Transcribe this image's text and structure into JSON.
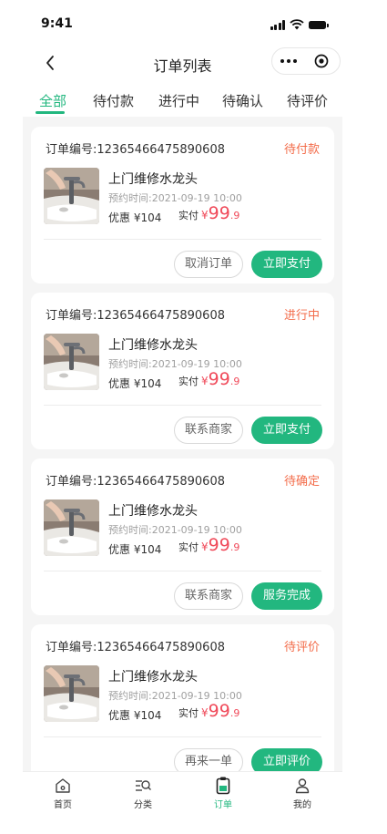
{
  "status_bar": {
    "time": "9:41"
  },
  "navbar": {
    "title": "订单列表",
    "back_icon": "chevron-left-icon",
    "more_icon": "more-dots-icon",
    "close_icon": "target-close-icon"
  },
  "tabs": [
    {
      "label": "全部",
      "active": true
    },
    {
      "label": "待付款",
      "active": false
    },
    {
      "label": "进行中",
      "active": false
    },
    {
      "label": "待确认",
      "active": false
    },
    {
      "label": "待评价",
      "active": false
    }
  ],
  "orders": [
    {
      "order_label": "订单编号:12365466475890608",
      "status": "待付款",
      "service": "上门维修水龙头",
      "appointment": "预约时间:2021-09-19 10:00",
      "discount": "优惠 ¥104",
      "paid_label": "实付",
      "currency": "¥",
      "price_main": "99",
      "price_cents": ".9",
      "secondary_button": "取消订单",
      "primary_button": "立即支付"
    },
    {
      "order_label": "订单编号:12365466475890608",
      "status": "进行中",
      "service": "上门维修水龙头",
      "appointment": "预约时间:2021-09-19 10:00",
      "discount": "优惠 ¥104",
      "paid_label": "实付",
      "currency": "¥",
      "price_main": "99",
      "price_cents": ".9",
      "secondary_button": "联系商家",
      "primary_button": "立即支付"
    },
    {
      "order_label": "订单编号:12365466475890608",
      "status": "待确定",
      "service": "上门维修水龙头",
      "appointment": "预约时间:2021-09-19 10:00",
      "discount": "优惠 ¥104",
      "paid_label": "实付",
      "currency": "¥",
      "price_main": "99",
      "price_cents": ".9",
      "secondary_button": "联系商家",
      "primary_button": "服务完成"
    },
    {
      "order_label": "订单编号:12365466475890608",
      "status": "待评价",
      "service": "上门维修水龙头",
      "appointment": "预约时间:2021-09-19 10:00",
      "discount": "优惠 ¥104",
      "paid_label": "实付",
      "currency": "¥",
      "price_main": "99",
      "price_cents": ".9",
      "secondary_button": "再来一单",
      "primary_button": "立即评价"
    }
  ],
  "tabbar": [
    {
      "label": "首页",
      "icon": "home-icon",
      "active": false
    },
    {
      "label": "分类",
      "icon": "category-search-icon",
      "active": false
    },
    {
      "label": "订单",
      "icon": "order-clipboard-icon",
      "active": true
    },
    {
      "label": "我的",
      "icon": "user-icon",
      "active": false
    }
  ],
  "colors": {
    "accent": "#22b77f",
    "status": "#f36c4a",
    "price": "#f04a5a",
    "background": "#f5f5f5"
  }
}
